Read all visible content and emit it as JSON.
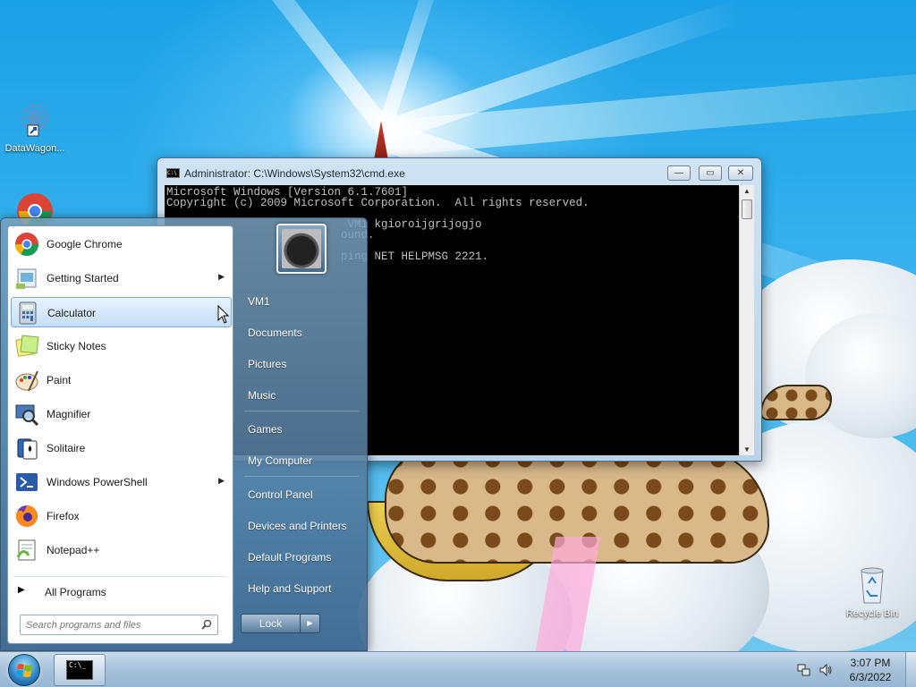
{
  "desktop": {
    "icons": [
      {
        "label": "DataWagon...",
        "icon": "datawagon-shortcut-icon"
      },
      {
        "label": "Recycle Bin",
        "icon": "recycle-bin-icon"
      }
    ]
  },
  "cmd_window": {
    "title": "Administrator: C:\\Windows\\System32\\cmd.exe",
    "minimize_label": "—",
    "maximize_label": "▭",
    "close_label": "✕",
    "console_lines": [
      "Microsoft Windows [Version 6.1.7601]",
      "Copyright (c) 2009 Microsoft Corporation.  All rights reserved.",
      "",
      "                           VM1 kgioroijgrijogjo",
      "                          ound.",
      "",
      "                          ping NET HELPMSG 2221."
    ]
  },
  "start_menu": {
    "programs": [
      {
        "label": "Google Chrome",
        "icon": "chrome-icon",
        "submenu": false
      },
      {
        "label": "Getting Started",
        "icon": "getting-started-icon",
        "submenu": true
      },
      {
        "label": "Calculator",
        "icon": "calculator-icon",
        "submenu": false
      },
      {
        "label": "Sticky Notes",
        "icon": "sticky-notes-icon",
        "submenu": false
      },
      {
        "label": "Paint",
        "icon": "paint-icon",
        "submenu": false
      },
      {
        "label": "Magnifier",
        "icon": "magnifier-icon",
        "submenu": false
      },
      {
        "label": "Solitaire",
        "icon": "solitaire-icon",
        "submenu": false
      },
      {
        "label": "Windows PowerShell",
        "icon": "powershell-icon",
        "submenu": true
      },
      {
        "label": "Firefox",
        "icon": "firefox-icon",
        "submenu": false
      },
      {
        "label": "Notepad++",
        "icon": "notepadplusplus-icon",
        "submenu": true
      }
    ],
    "hovered_item": "Calculator",
    "all_programs_label": "All Programs",
    "search_placeholder": "Search programs and files",
    "right_items": [
      "VM1",
      "Documents",
      "Pictures",
      "Music",
      "Games",
      "My Computer",
      "Control Panel",
      "Devices and Printers",
      "Default Programs",
      "Help and Support"
    ],
    "lock_label": "Lock",
    "lock_arrow": "▶"
  },
  "taskbar": {
    "time": "3:07 PM",
    "date": "6/3/2022",
    "cmd_task_glyph": "C:\\_"
  },
  "colors": {
    "sky": "#1aa0e6",
    "taskbar": "#a8c3db",
    "start_menu_right": "#4f7393",
    "hover": "#c6def6"
  }
}
